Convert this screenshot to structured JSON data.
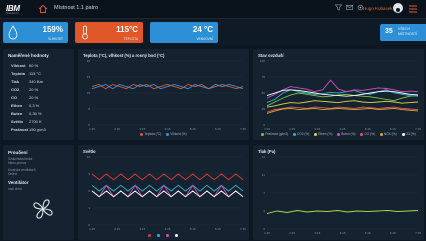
{
  "header": {
    "logo": "IBM",
    "logo_sub": "Solutions",
    "title": "Místnost 1.1 patro",
    "user": "Hugo Kubasek"
  },
  "kpis": {
    "humidity": {
      "value": "159%",
      "label": "VLHKOST",
      "color": "#2d8fd6"
    },
    "temperature": {
      "value": "115°C",
      "label": "TEPLOTA",
      "color": "#e0572a"
    },
    "ambient": {
      "value": "24 °C",
      "label": "VENKOVNÍ",
      "color": "#2d8fd6"
    },
    "status": {
      "value": "35",
      "label": "VŠECH MÍSTNOSTÍ"
    }
  },
  "sensors": {
    "title": "Naměřené hodnoty",
    "rows": [
      {
        "k": "Vlhkost",
        "v": "60 %"
      },
      {
        "k": "Teplota",
        "v": "115 °C"
      },
      {
        "k": "Tlak",
        "v": "340 Bar"
      },
      {
        "k": "CO2",
        "v": "20 %"
      },
      {
        "k": "CO",
        "v": "20 %"
      },
      {
        "k": "Ethen",
        "v": "0,3 %"
      },
      {
        "k": "Buten",
        "v": "0,36 %"
      },
      {
        "k": "Světlo",
        "v": "2700 K"
      },
      {
        "k": "Prašnost",
        "v": "150 g/m3"
      }
    ]
  },
  "status_panel": {
    "title1": "Prouδení",
    "sub1a": "Vzduchotechnika",
    "sub1b": "Mimo provoz",
    "sub2a": "Kontrola ventilátorů",
    "sub2b": "Online",
    "title2": "Ventilátor",
    "sub3": "nočí chod"
  },
  "charts": {
    "c1": {
      "title": "Teplota (°C), vlhkost (%) a rosný bod (°C)",
      "legend": [
        "Teplota (°C)",
        "Vlhkost (%)"
      ]
    },
    "c2": {
      "title": "Stav ovzduší",
      "legend": [
        "Prašnost (g/m3)",
        "CO2 (%)",
        "Ethen (%)",
        "Buten (%)",
        "CO (%)",
        "NOX (%)",
        "O3 (%)"
      ]
    },
    "c3": {
      "title": "Světlo"
    },
    "c4": {
      "title": "Tlak (Pa)"
    },
    "xticks": [
      "1:15",
      "2:15",
      "3:15",
      "4:15",
      "5:15",
      "6:15",
      "7:15"
    ],
    "xticks_tail": "4 AM"
  },
  "chart_data": [
    {
      "type": "line",
      "title": "Teplota (°C), vlhkost (%) a rosný bod (°C)",
      "ylim": [
        0,
        30
      ],
      "x": [
        "1:15",
        "2:15",
        "3:15",
        "4:15",
        "5:15",
        "6:15",
        "7:15"
      ],
      "series": [
        {
          "name": "Teplota (°C)",
          "color": "#e0572a",
          "values": [
            18,
            19,
            17,
            19,
            18,
            17,
            19,
            18,
            19,
            17,
            18,
            19,
            18,
            17,
            19,
            18,
            19,
            17,
            18,
            19,
            18,
            17,
            18
          ]
        },
        {
          "name": "Vlhkost (%)",
          "color": "#3f8fd6",
          "values": [
            17,
            18,
            19,
            17,
            19,
            18,
            17,
            19,
            18,
            19,
            17,
            18,
            19,
            18,
            17,
            19,
            18,
            17,
            19,
            18,
            19,
            18,
            17
          ]
        }
      ]
    },
    {
      "type": "line",
      "title": "Stav ovzduší",
      "ylim": [
        0,
        100
      ],
      "x": [
        "1:15",
        "2:15",
        "3:15",
        "4:15",
        "5:15",
        "6:15",
        "7:15"
      ],
      "series": [
        {
          "name": "Prašnost (g/m3)",
          "color": "#7fc241",
          "values": [
            30,
            36,
            42,
            47,
            50,
            48,
            46,
            44,
            45,
            47,
            48,
            46,
            45,
            44,
            42,
            40,
            38,
            42,
            45,
            46
          ]
        },
        {
          "name": "CO2 (%)",
          "color": "#2db3c9",
          "values": [
            35,
            40,
            50,
            55,
            52,
            50,
            48,
            49,
            51,
            50,
            52,
            54,
            50,
            48,
            52,
            55,
            50,
            48,
            46,
            45
          ]
        },
        {
          "name": "Ethen (%)",
          "color": "#d6d64b",
          "values": [
            28,
            30,
            33,
            35,
            34,
            36,
            38,
            37,
            36,
            35,
            37,
            38,
            36,
            35,
            36,
            37,
            36,
            34,
            35,
            36
          ]
        },
        {
          "name": "Buten (%)",
          "color": "#d64bc4",
          "values": [
            42,
            48,
            55,
            60,
            58,
            56,
            52,
            55,
            70,
            56,
            52,
            55,
            54,
            56,
            58,
            57,
            55,
            52,
            53,
            52
          ]
        },
        {
          "name": "CO (%)",
          "color": "#e05a5a",
          "values": [
            20,
            24,
            26,
            28,
            27,
            26,
            28,
            27,
            26,
            28,
            27,
            26,
            28,
            27,
            26,
            27,
            28,
            26,
            25,
            24
          ]
        },
        {
          "name": "NOX (%)",
          "color": "#e0a52a",
          "values": [
            18,
            22,
            25,
            26,
            24,
            25,
            26,
            24,
            25,
            26,
            25,
            24,
            25,
            26,
            24,
            25,
            26,
            24,
            23,
            22
          ]
        },
        {
          "name": "O3 (%)",
          "color": "#ffffff",
          "values": [
            46,
            50,
            54,
            55,
            54,
            52,
            50,
            48,
            47,
            46,
            45,
            46,
            48,
            50,
            52,
            53,
            52,
            50,
            48,
            47
          ]
        }
      ]
    },
    {
      "type": "line",
      "title": "Světlo",
      "ylim": [
        0,
        12
      ],
      "x": [
        "1:15",
        "2:15",
        "3:15",
        "4:15",
        "5:15",
        "6:15",
        "7:15"
      ],
      "series": [
        {
          "name": "",
          "color": "#e03a3a",
          "values": [
            9,
            8,
            9,
            8,
            9,
            8,
            9,
            8,
            9,
            8,
            9,
            8,
            9,
            8,
            9,
            8,
            9,
            8,
            9,
            8,
            9,
            8
          ]
        },
        {
          "name": "",
          "color": "#2db3c9",
          "values": [
            7,
            6,
            7,
            6,
            7,
            6,
            7,
            6,
            7,
            6,
            7,
            6,
            7,
            6,
            7,
            6,
            7,
            6,
            7,
            6,
            7,
            6
          ]
        },
        {
          "name": "",
          "color": "#d64bc4",
          "values": [
            6,
            5,
            7,
            5,
            6,
            5,
            7,
            5,
            6,
            5,
            7,
            5,
            6,
            5,
            7,
            5,
            6,
            5,
            7,
            5,
            6,
            5
          ]
        },
        {
          "name": "",
          "color": "#ffffff",
          "values": [
            6,
            5,
            6,
            5,
            6,
            5,
            6,
            5,
            6,
            5,
            6,
            5,
            6,
            5,
            6,
            5,
            6,
            5,
            6,
            5,
            6,
            5
          ]
        }
      ]
    },
    {
      "type": "line",
      "title": "Tlak (Pa)",
      "ylim": [
        0,
        14
      ],
      "x": [
        "1:15",
        "2:15",
        "3:15",
        "4:15",
        "5:15",
        "6:15",
        "7:15"
      ],
      "series": [
        {
          "name": "",
          "color": "#a8d64b",
          "values": [
            3,
            3.5,
            3.2,
            3.6,
            3.3,
            3.5,
            3.4,
            3.6,
            3.3,
            3.5,
            3.4,
            3.5,
            3.6,
            3.4,
            3.5,
            3.6
          ]
        }
      ]
    }
  ]
}
